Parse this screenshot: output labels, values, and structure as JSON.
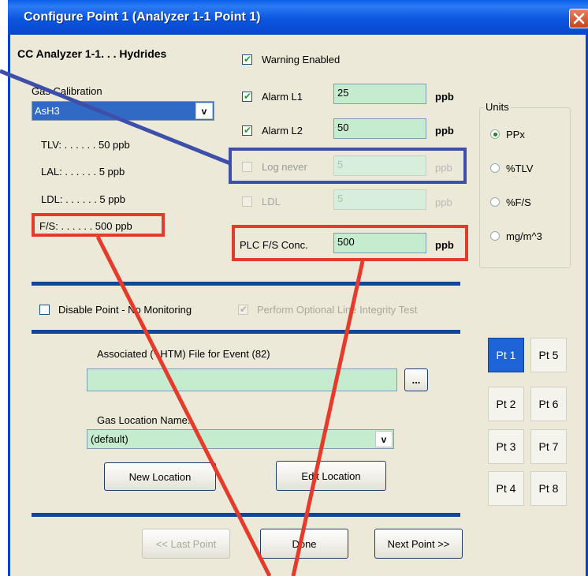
{
  "window": {
    "title": "Configure Point 1  (Analyzer 1-1  Point 1)",
    "close_label": "close"
  },
  "header": {
    "analyzer_label": "CC Analyzer 1-1. . .  Hydrides"
  },
  "gas_calibration": {
    "label": "Gas Calibration",
    "selected": "AsH3",
    "arrow": "v"
  },
  "limits": {
    "tlv": "TLV: . . . . . .  50  ppb",
    "lal": "LAL: . . . . . .   5  ppb",
    "ldl": "LDL: . . . . . .   5  ppb",
    "fs": "F/S: . . . . . . 500  ppb"
  },
  "alarms": {
    "warning_enabled": {
      "label": "Warning Enabled",
      "checked": true
    },
    "alarm_l1": {
      "label": "Alarm L1",
      "value": "25",
      "unit": "ppb",
      "checked": true
    },
    "alarm_l2": {
      "label": "Alarm L2",
      "value": "50",
      "unit": "ppb",
      "checked": true
    },
    "log_never": {
      "label": "Log never",
      "value": "5",
      "unit": "ppb",
      "checked": false
    },
    "ldl": {
      "label": "LDL",
      "value": "5",
      "unit": "ppb",
      "checked": false
    },
    "plc_fs": {
      "label": "PLC F/S Conc.",
      "value": "500",
      "unit": "ppb"
    }
  },
  "units": {
    "label": "Units",
    "options": [
      "PPx",
      "%TLV",
      "%F/S",
      "mg/m^3"
    ],
    "selected": "PPx"
  },
  "options": {
    "disable_point": "Disable Point - No Monitoring",
    "line_integrity": "Perform Optional Line Integrity Test"
  },
  "event_file": {
    "label": "Associated (*.HTM) File for Event (82)",
    "value": "",
    "browse": "..."
  },
  "location": {
    "label": "Gas Location Name:",
    "selected": "(default)",
    "arrow": "v",
    "new_button": "New Location",
    "edit_button": "Edit Location"
  },
  "points": [
    "Pt 1",
    "Pt 2",
    "Pt 3",
    "Pt 4",
    "Pt 5",
    "Pt 6",
    "Pt 7",
    "Pt 8"
  ],
  "active_point": "Pt 1",
  "footer": {
    "last_point": "<< Last Point",
    "done": "Done",
    "next_point": "Next Point >>"
  },
  "colors": {
    "title_bar": "#0b56e0",
    "input_fill": "#c5eccf",
    "highlight_red": "#e63a2a",
    "highlight_blue": "#3d4fa8",
    "separator": "#10479a"
  }
}
